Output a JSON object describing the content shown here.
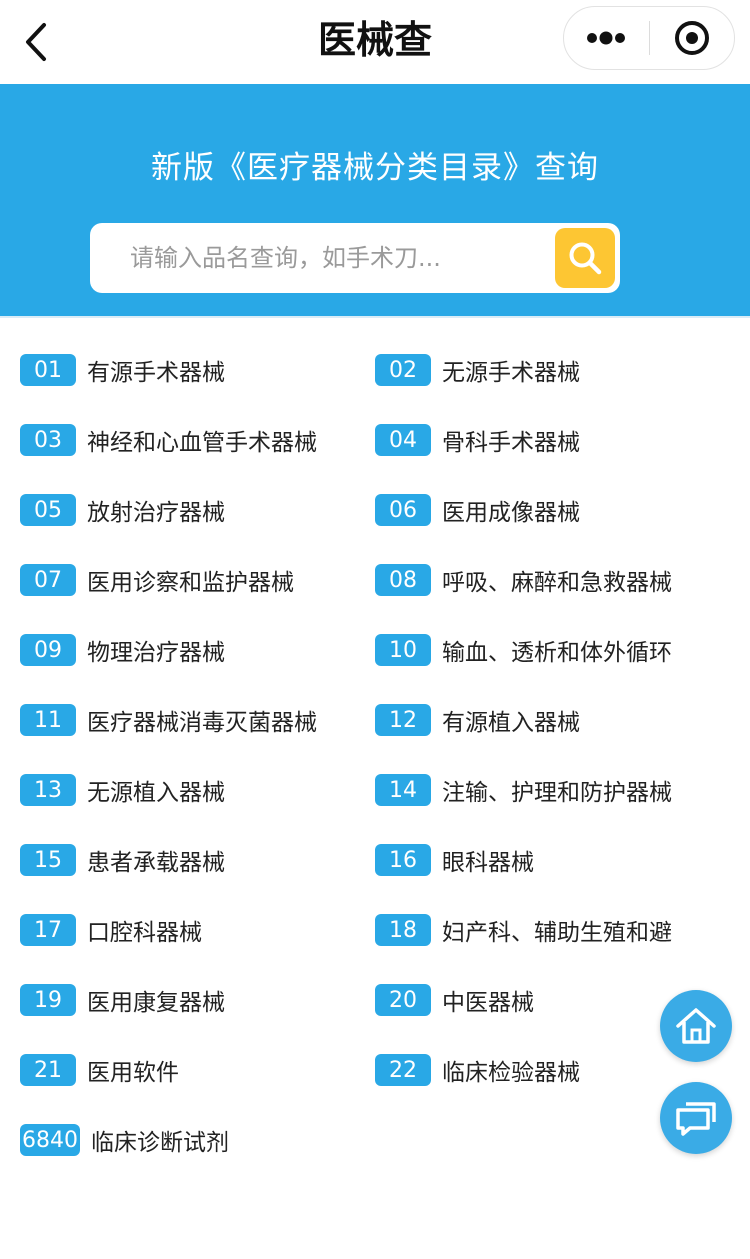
{
  "nav": {
    "title": "医械查"
  },
  "banner": {
    "title": "新版《医疗器械分类目录》查询",
    "search_placeholder": "请输入品名查询，如手术刀...",
    "search_value": ""
  },
  "colors": {
    "accent": "#29a8e6",
    "search_button": "#fdc633"
  },
  "categories": [
    {
      "code": "01",
      "name": "有源手术器械"
    },
    {
      "code": "02",
      "name": "无源手术器械"
    },
    {
      "code": "03",
      "name": "神经和心血管手术器械"
    },
    {
      "code": "04",
      "name": "骨科手术器械"
    },
    {
      "code": "05",
      "name": "放射治疗器械"
    },
    {
      "code": "06",
      "name": "医用成像器械"
    },
    {
      "code": "07",
      "name": "医用诊察和监护器械"
    },
    {
      "code": "08",
      "name": "呼吸、麻醉和急救器械"
    },
    {
      "code": "09",
      "name": "物理治疗器械"
    },
    {
      "code": "10",
      "name": "输血、透析和体外循环"
    },
    {
      "code": "11",
      "name": "医疗器械消毒灭菌器械"
    },
    {
      "code": "12",
      "name": "有源植入器械"
    },
    {
      "code": "13",
      "name": "无源植入器械"
    },
    {
      "code": "14",
      "name": "注输、护理和防护器械"
    },
    {
      "code": "15",
      "name": "患者承载器械"
    },
    {
      "code": "16",
      "name": "眼科器械"
    },
    {
      "code": "17",
      "name": "口腔科器械"
    },
    {
      "code": "18",
      "name": "妇产科、辅助生殖和避"
    },
    {
      "code": "19",
      "name": "医用康复器械"
    },
    {
      "code": "20",
      "name": "中医器械"
    },
    {
      "code": "21",
      "name": "医用软件"
    },
    {
      "code": "22",
      "name": "临床检验器械"
    },
    {
      "code": "6840",
      "name": "临床诊断试剂"
    }
  ],
  "icons": {
    "back": "chevron-left-icon",
    "more": "more-dots-icon",
    "close": "target-circle-icon",
    "search": "search-icon",
    "home": "home-icon",
    "chat": "chat-bubble-icon"
  }
}
